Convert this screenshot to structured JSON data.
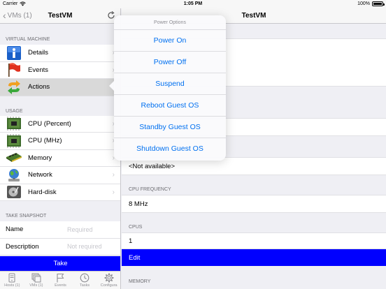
{
  "status_bar": {
    "carrier": "Carrier",
    "time": "1:05 PM",
    "battery": "100%",
    "battery_level": 1.0
  },
  "left_nav": {
    "back_label": "VMs (1)",
    "title": "TestVM"
  },
  "sections": {
    "virtual_machine": "VIRTUAL MACHINE",
    "usage": "USAGE",
    "take_snapshot": "TAKE SNAPSHOT"
  },
  "vm_items": [
    {
      "label": "Details",
      "icon": "info-icon"
    },
    {
      "label": "Events",
      "icon": "flag-icon"
    },
    {
      "label": "Actions",
      "icon": "arrows-icon"
    }
  ],
  "usage_items": [
    {
      "label": "CPU (Percent)",
      "icon": "cpu-chip-icon"
    },
    {
      "label": "CPU (MHz)",
      "icon": "cpu-chip-icon"
    },
    {
      "label": "Memory",
      "icon": "memory-module-icon"
    },
    {
      "label": "Network",
      "icon": "globe-network-icon"
    },
    {
      "label": "Hard-disk",
      "icon": "hard-disk-icon"
    }
  ],
  "snapshot_form": {
    "name_label": "Name",
    "name_placeholder": "Required",
    "description_label": "Description",
    "description_placeholder": "Not required",
    "take_label": "Take"
  },
  "tabs": [
    {
      "label": "Hosts (1)",
      "icon": "hosts-icon"
    },
    {
      "label": "VMs (1)",
      "icon": "vms-icon"
    },
    {
      "label": "Events",
      "icon": "flag-icon"
    },
    {
      "label": "Tasks",
      "icon": "clock-icon"
    },
    {
      "label": "Configura",
      "icon": "gear-icon"
    }
  ],
  "right_nav": {
    "title": "TestVM"
  },
  "details": {
    "not_available": "<Not available>",
    "cpu_frequency_header": "CPU FREQUENCY",
    "cpu_frequency_value": "8 MHz",
    "cpus_header": "CPUS",
    "cpus_value": "1",
    "edit_label": "Edit",
    "memory_header": "MEMORY"
  },
  "popover": {
    "title": "Power Options",
    "items": [
      "Power On",
      "Power Off",
      "Suspend",
      "Reboot Guest OS",
      "Standby Guest OS",
      "Shutdown Guest OS"
    ]
  },
  "colors": {
    "accent": "#0000ff",
    "link": "#0070f0"
  }
}
